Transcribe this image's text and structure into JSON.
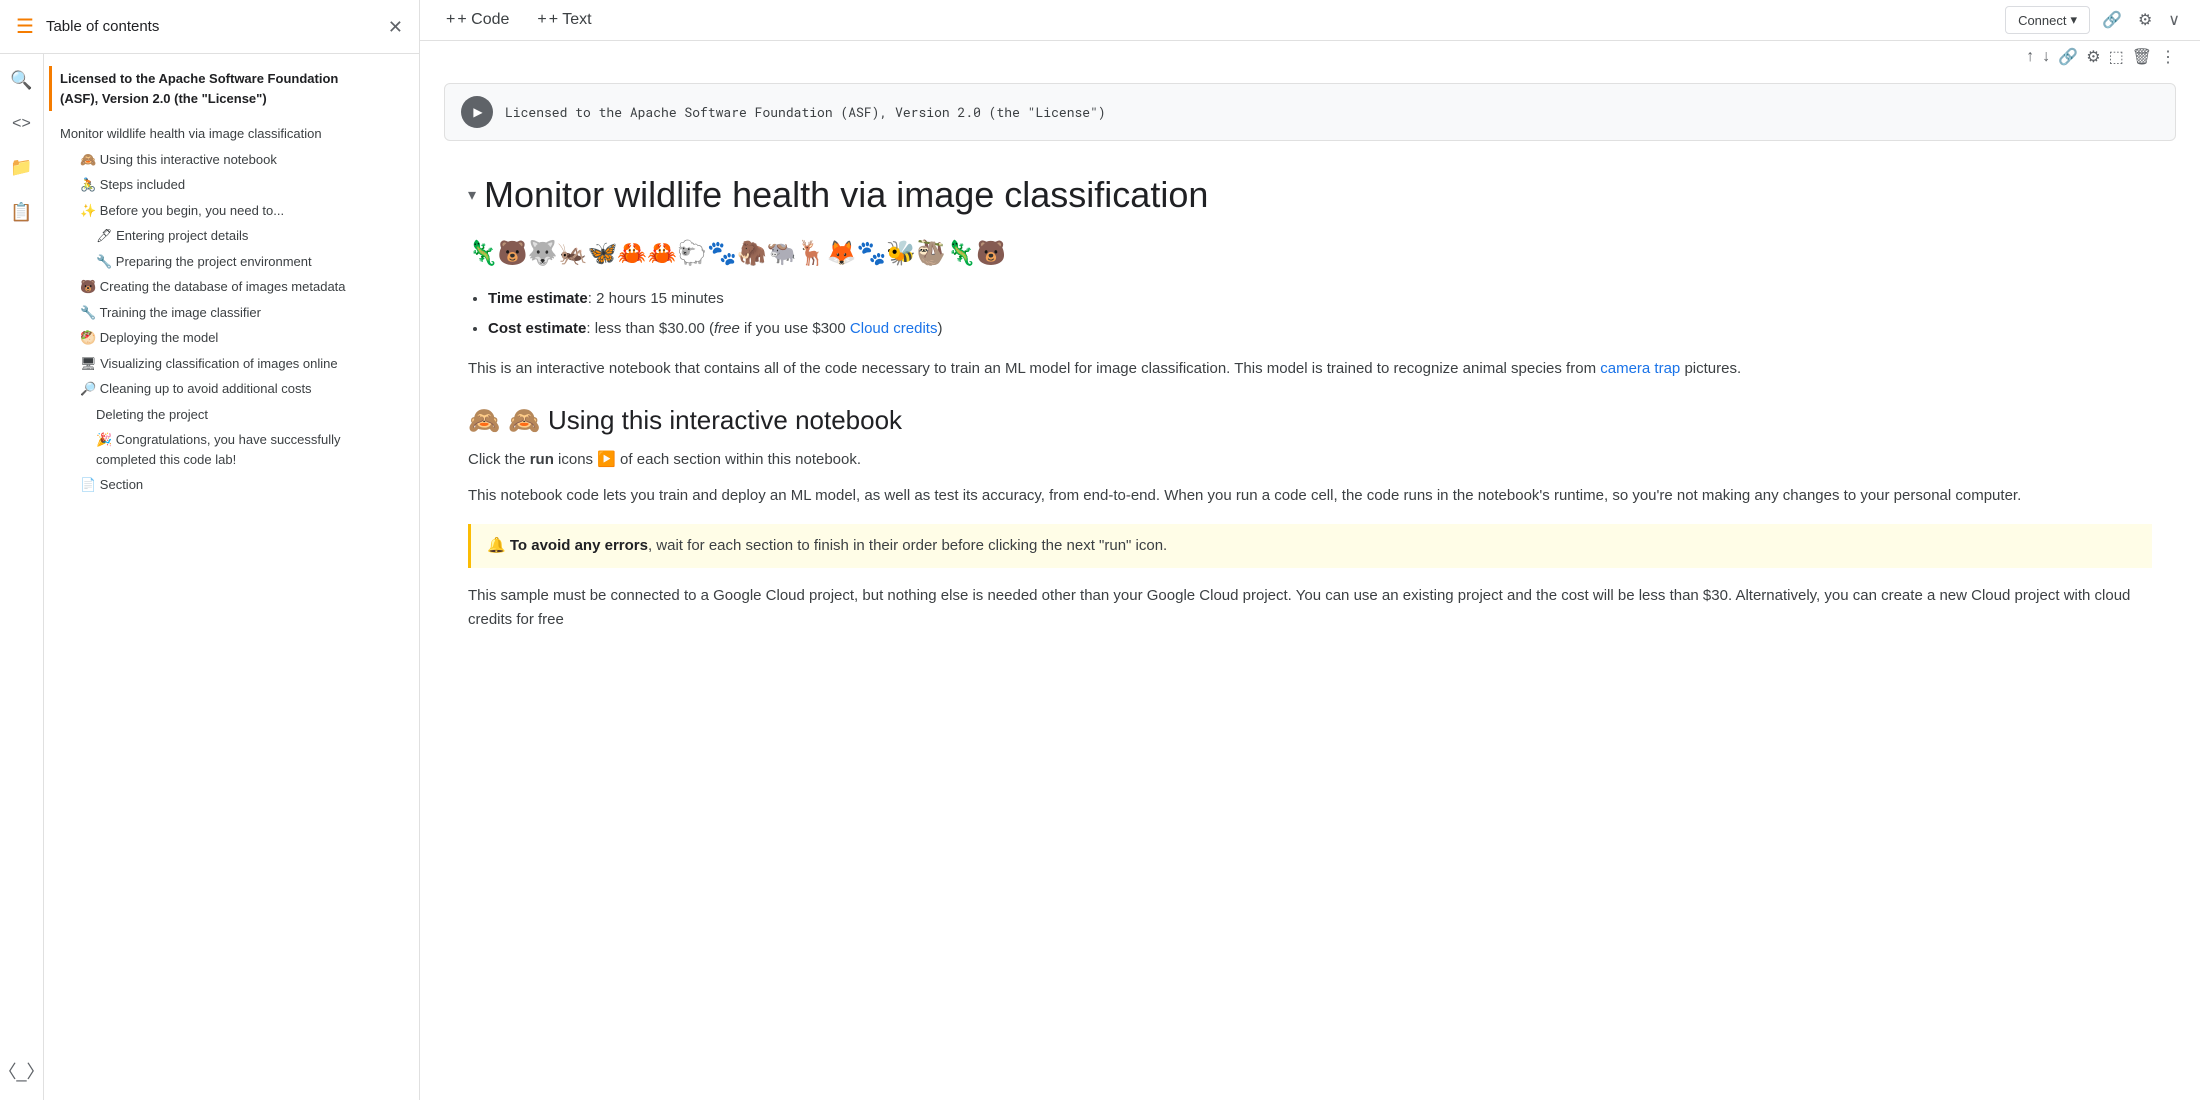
{
  "sidebar": {
    "title": "Table of contents",
    "close_icon": "✕",
    "icon_hamburger": "☰",
    "icons": [
      "🔍",
      "◁▷",
      "☐",
      "☰",
      "⬛"
    ],
    "toc_items": [
      {
        "label": "Licensed to the Apache Software Foundation (ASF), Version 2.0 (the \"License\")",
        "level": "bold",
        "emoji": ""
      },
      {
        "label": "Monitor wildlife health via image classification",
        "level": "level1",
        "emoji": ""
      },
      {
        "label": "🙈 Using this interactive notebook",
        "level": "level2",
        "emoji": ""
      },
      {
        "label": "🚴 Steps included",
        "level": "level2",
        "emoji": ""
      },
      {
        "label": "✨ Before you begin, you need to...",
        "level": "level2",
        "emoji": ""
      },
      {
        "label": "🖊 Entering project details",
        "level": "level3",
        "emoji": ""
      },
      {
        "label": "🔧 Preparing the project environment",
        "level": "level3",
        "emoji": ""
      },
      {
        "label": "🐻 Creating the database of images metadata",
        "level": "level2",
        "emoji": ""
      },
      {
        "label": "🔧 Training the image classifier",
        "level": "level2",
        "emoji": ""
      },
      {
        "label": "🥙 Deploying the model",
        "level": "level2",
        "emoji": ""
      },
      {
        "label": "🖥 Visualizing classification of images online",
        "level": "level2",
        "emoji": ""
      },
      {
        "label": "🔎 Cleaning up to avoid additional costs",
        "level": "level2",
        "emoji": ""
      },
      {
        "label": "Deleting the project",
        "level": "level3",
        "emoji": ""
      },
      {
        "label": "🎉 Congratulations, you have successfully completed this code lab!",
        "level": "level3",
        "emoji": ""
      },
      {
        "label": "📄 Section",
        "level": "level2",
        "emoji": ""
      }
    ]
  },
  "toolbar": {
    "code_btn": "+ Code",
    "text_btn": "+ Text",
    "connect_btn": "Connect",
    "chevron_down": "▾"
  },
  "cell": {
    "text": "Licensed to the Apache Software Foundation (ASF), Version 2.0 (the \"License\")"
  },
  "notebook": {
    "main_title": "Monitor wildlife health via image classification",
    "emoji_row": "🦎🐻🐺🦗🦋🦀🦀🐑🐾🦣🐃🦌🦊🐾🐝🦥🦎🐻",
    "bullets": [
      {
        "label": "Time estimate",
        "text": ": 2 hours 15 minutes"
      },
      {
        "label": "Cost estimate",
        "text": ": less than $30.00 (",
        "italic": "free",
        "link_text": "Cloud credits",
        "link_url": "#",
        "suffix": " if you use $300 ",
        "end": ")"
      }
    ],
    "body1": "This is an interactive notebook that contains all of the code necessary to train an ML model for image classification. This model is trained to recognize animal species from",
    "body1_link": "camera trap",
    "body1_end": "pictures.",
    "section2_title": "🙈 Using this interactive notebook",
    "section2_p1_before": "Click the ",
    "section2_p1_bold": "run",
    "section2_p1_middle": " icons ▶️ of each section within this notebook.",
    "section2_p2": "This notebook code lets you train and deploy an ML model, as well as test its accuracy, from end-to-end. When you run a code cell, the code runs in the notebook's runtime, so you're not making any changes to your personal computer.",
    "warning_bold": "To avoid any errors",
    "warning_text": ", wait for each section to finish in their order before clicking the next \"run\" icon.",
    "section2_p3": "This sample must be connected to a Google Cloud project, but nothing else is needed other than your Google Cloud project. You can use an existing project and the cost will be less than $30. Alternatively, you can create a new Cloud project with cloud credits for free"
  }
}
